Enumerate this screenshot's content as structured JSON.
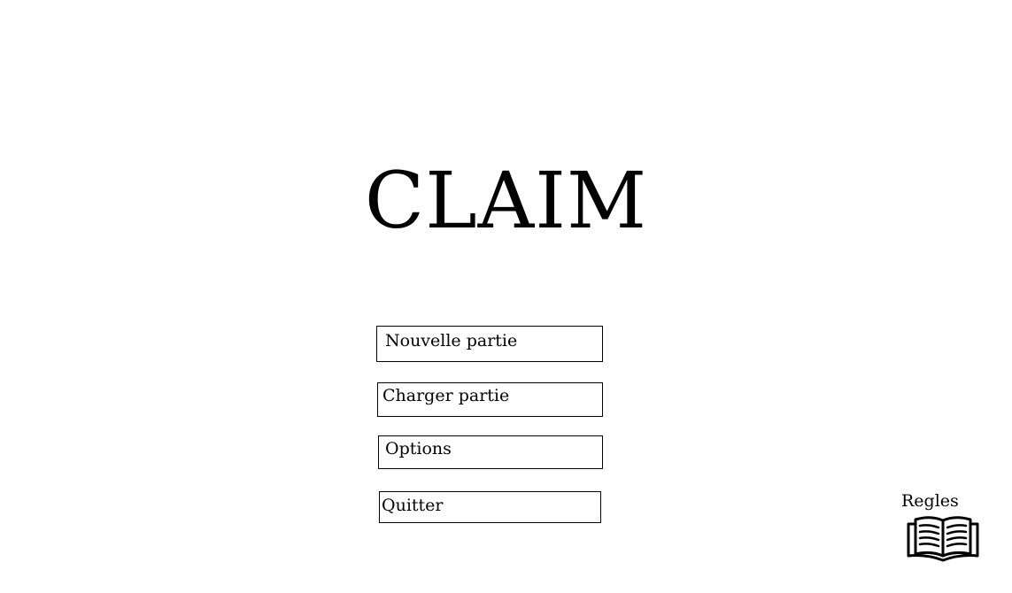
{
  "game": {
    "title": "CLAIM"
  },
  "menu": {
    "new_game": "Nouvelle partie",
    "load_game": "Charger partie",
    "options": "Options",
    "quit": "Quitter"
  },
  "rules": {
    "label": "Regles",
    "icon": "open-book-icon"
  }
}
